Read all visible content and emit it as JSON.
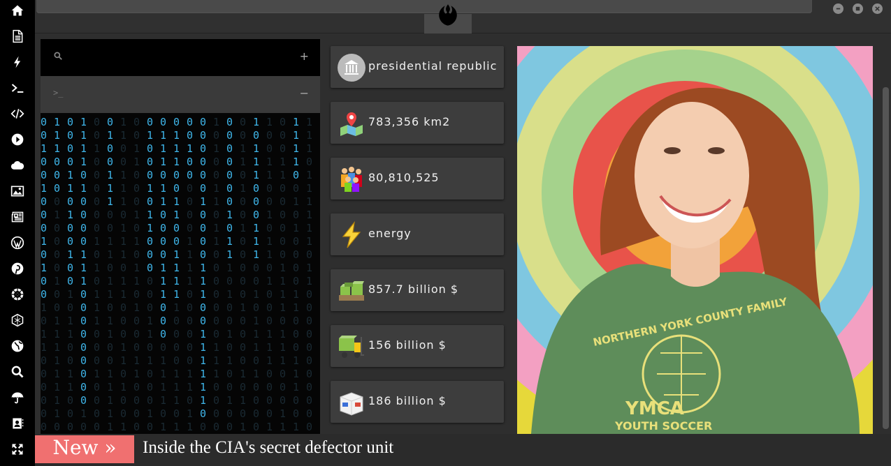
{
  "topbar": {
    "window_controls": [
      "minimize",
      "maximize",
      "close"
    ]
  },
  "sidebar": {
    "icons": [
      "home-icon",
      "document-icon",
      "bolt-icon",
      "terminal-icon",
      "code-icon",
      "play-icon",
      "cloud-icon",
      "image-icon",
      "newspaper-icon",
      "wordpress-icon",
      "pinterest-icon",
      "empire-icon",
      "hexagon-icon",
      "globe-icon",
      "search-icon",
      "umbrella-icon",
      "contact-icon",
      "expand-icon"
    ]
  },
  "left_panel": {
    "search_icon": "search-icon",
    "search_add": "+",
    "terminal_prompt": ">_",
    "terminal_toggle": "−"
  },
  "stats": [
    {
      "icon": "government-building-icon",
      "text": "presidential republic"
    },
    {
      "icon": "map-pin-icon",
      "text": "783,356 km2"
    },
    {
      "icon": "people-icon",
      "text": "80,810,525"
    },
    {
      "icon": "lightning-icon",
      "text": "energy"
    },
    {
      "icon": "money-stack-icon",
      "text": "857.7 billion $"
    },
    {
      "icon": "forklift-icon",
      "text": "156 billion $"
    },
    {
      "icon": "shipping-box-icon",
      "text": "186 billion $"
    }
  ],
  "photo": {
    "shirt_line1": "NORTHERN YORK COUNTY FAMILY",
    "shirt_line2": "YMCA",
    "shirt_line3": "YOUTH SOCCER"
  },
  "ticker": {
    "badge": "New »",
    "headline": "Inside the CIA's secret defector unit"
  },
  "colors": {
    "accent": "#f07070",
    "matrix_bright": "#3fb6ea",
    "matrix_dim": "#1a2a33"
  }
}
